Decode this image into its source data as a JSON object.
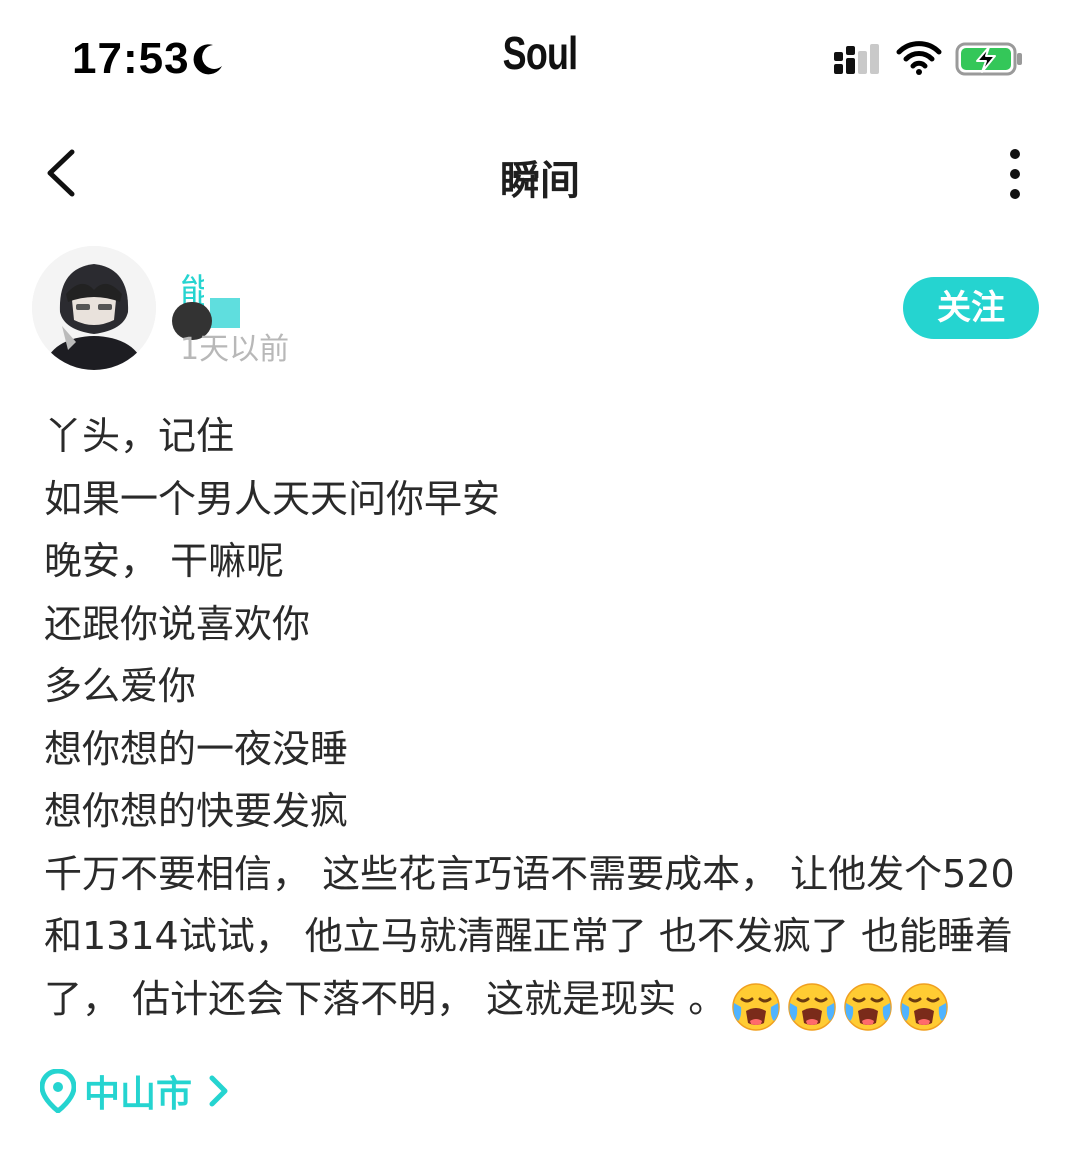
{
  "status_bar": {
    "time": "17:53",
    "app_name": "Soul",
    "icons": [
      "moon-icon",
      "signal-icon",
      "wifi-icon",
      "battery-charging-icon"
    ]
  },
  "nav": {
    "title": "瞬间",
    "back_icon": "chevron-left-icon",
    "more_icon": "more-vertical-icon"
  },
  "post": {
    "author_name": "能 哥",
    "timestamp": "1天以前",
    "follow_label": "关注",
    "lines": [
      "丫头，记住",
      "如果一个男人天天问你早安",
      "晚安，  干嘛呢",
      "还跟你说喜欢你",
      "多么爱你",
      "想你想的一夜没睡",
      "想你想的快要发疯",
      "千万不要相信，  这些花言巧语不需要成本，  让他发个520",
      "和1314试试，  他立马就清醒正常了  也不发疯了  也能睡着",
      "了，  估计还会下落不明，  这就是现实  。"
    ],
    "emoji_count": 4,
    "emoji_icon": "loudly-crying-face-icon",
    "location": "中山市",
    "location_icon": "location-pin-icon"
  },
  "colors": {
    "accent": "#25d4d0",
    "text": "#2a2a2a",
    "muted": "#b8b8b8"
  }
}
